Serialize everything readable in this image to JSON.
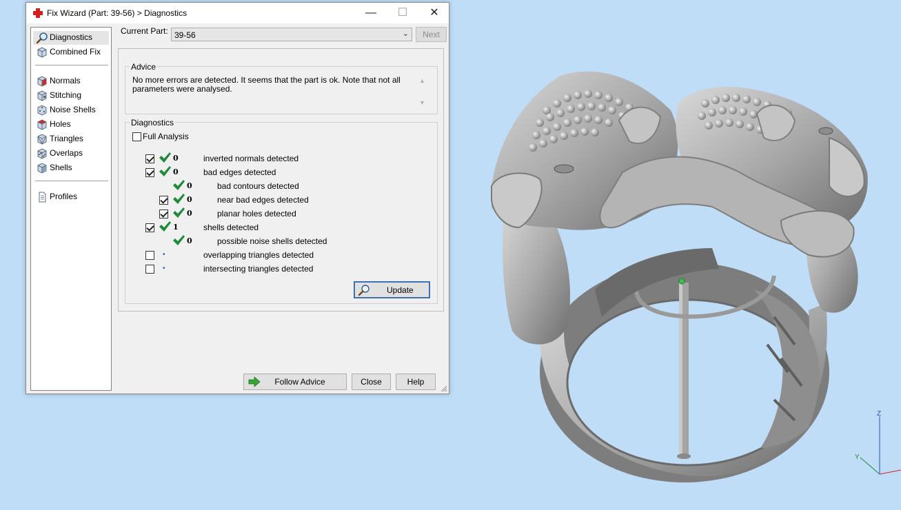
{
  "window": {
    "title": "Fix Wizard (Part: 39-56) > Diagnostics",
    "minimize_label": "—",
    "maximize_label": "☐",
    "close_label": "✕"
  },
  "sidebar": {
    "items": [
      {
        "label": "Diagnostics",
        "icon": "magnifier-icon",
        "selected": true
      },
      {
        "label": "Combined Fix",
        "icon": "cube-icon"
      },
      {
        "label": "Normals",
        "icon": "normals-cube-icon"
      },
      {
        "label": "Stitching",
        "icon": "stitching-cube-icon"
      },
      {
        "label": "Noise Shells",
        "icon": "noise-shells-cube-icon"
      },
      {
        "label": "Holes",
        "icon": "holes-cube-icon"
      },
      {
        "label": "Triangles",
        "icon": "triangles-cube-icon"
      },
      {
        "label": "Overlaps",
        "icon": "overlaps-cube-icon"
      },
      {
        "label": "Shells",
        "icon": "shells-cube-icon"
      },
      {
        "label": "Profiles",
        "icon": "document-icon"
      }
    ]
  },
  "part": {
    "label": "Current Part:",
    "value": "39-56",
    "next_label": "Next"
  },
  "advice": {
    "title": "Advice",
    "text": "No more errors are detected. It seems that the part is ok. Note that not all parameters were analysed."
  },
  "diagnostics": {
    "title": "Diagnostics",
    "full_analysis_label": "Full Analysis",
    "full_analysis_checked": false,
    "rows": [
      {
        "checked": true,
        "has_checkbox": true,
        "status": "ok",
        "count": "0",
        "text": "inverted normals detected",
        "indent": 0
      },
      {
        "checked": true,
        "has_checkbox": true,
        "status": "ok",
        "count": "0",
        "text": "bad edges detected",
        "indent": 0
      },
      {
        "checked": false,
        "has_checkbox": false,
        "status": "ok",
        "count": "0",
        "text": "bad contours detected",
        "indent": 1
      },
      {
        "checked": true,
        "has_checkbox": true,
        "status": "ok",
        "count": "0",
        "text": "near bad edges detected",
        "indent": 1
      },
      {
        "checked": true,
        "has_checkbox": true,
        "status": "ok",
        "count": "0",
        "text": "planar holes detected",
        "indent": 1
      },
      {
        "checked": true,
        "has_checkbox": true,
        "status": "ok",
        "count": "1",
        "text": "shells detected",
        "indent": 0
      },
      {
        "checked": false,
        "has_checkbox": false,
        "status": "ok",
        "count": "0",
        "text": "possible noise shells detected",
        "indent": 1
      },
      {
        "checked": false,
        "has_checkbox": true,
        "status": "pending",
        "count": "",
        "text": "overlapping triangles detected",
        "indent": 0
      },
      {
        "checked": false,
        "has_checkbox": true,
        "status": "pending",
        "count": "",
        "text": "intersecting triangles detected",
        "indent": 0
      }
    ],
    "update_label": "Update"
  },
  "footer": {
    "follow_label": "Follow Advice",
    "close_label": "Close",
    "help_label": "Help"
  },
  "viewport": {
    "background": "#bfddf7",
    "axis_z": "Z",
    "axis_y": "Y"
  },
  "colors": {
    "check_green": "#1f8a3a",
    "app_icon_red": "#d22020",
    "update_border": "#3f6fb5"
  }
}
